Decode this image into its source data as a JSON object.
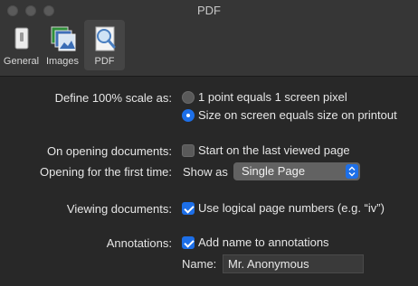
{
  "window": {
    "title": "PDF",
    "window_controls": [
      "close-button",
      "minimize-button",
      "zoom-button"
    ]
  },
  "toolbar": {
    "tabs": [
      {
        "label": "General",
        "icon": "general-switch-icon",
        "selected": false
      },
      {
        "label": "Images",
        "icon": "images-stack-icon",
        "selected": false
      },
      {
        "label": "PDF",
        "icon": "pdf-magnifier-icon",
        "selected": true
      }
    ]
  },
  "settings": {
    "scale": {
      "label": "Define 100% scale as:",
      "options": [
        {
          "label": "1 point equals 1 screen pixel",
          "selected": false
        },
        {
          "label": "Size on screen equals size on printout",
          "selected": true
        }
      ]
    },
    "opening_documents": {
      "label": "On opening documents:",
      "checkbox_label": "Start on the last viewed page",
      "checked": false
    },
    "first_time": {
      "label": "Opening for the first time:",
      "prefix": "Show as",
      "selected_value": "Single Page"
    },
    "viewing": {
      "label": "Viewing documents:",
      "checkbox_label": "Use logical page numbers (e.g. “iv”)",
      "checked": true
    },
    "annotations": {
      "label": "Annotations:",
      "checkbox_label": "Add name to annotations",
      "checked": true,
      "name_label": "Name:",
      "name_value": "Mr. Anonymous"
    }
  },
  "colors": {
    "accent": "#1d6fe8",
    "background": "#282828",
    "toolbar": "#363636"
  }
}
